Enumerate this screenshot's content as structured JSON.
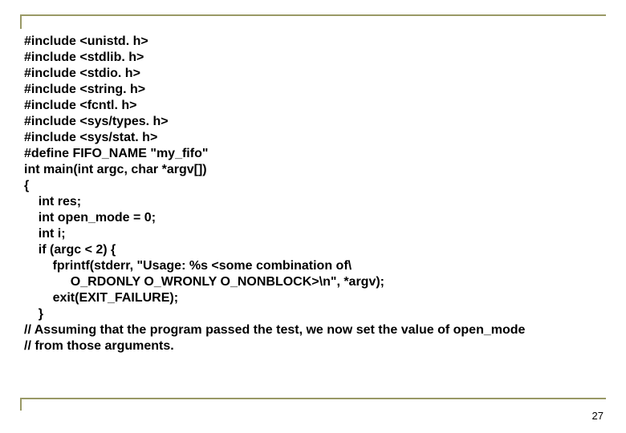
{
  "code": {
    "l1": "#include <unistd. h>",
    "l2": "#include <stdlib. h>",
    "l3": "#include <stdio. h>",
    "l4": "#include <string. h>",
    "l5": "#include <fcntl. h>",
    "l6": "#include <sys/types. h>",
    "l7": "#include <sys/stat. h>",
    "l8": "#define FIFO_NAME \"my_fifo\"",
    "l9": "int main(int argc, char *argv[])",
    "l10": "{",
    "l11": "    int res;",
    "l12": "    int open_mode = 0;",
    "l13": "    int i;",
    "l14": "    if (argc < 2) {",
    "l15": "        fprintf(stderr, \"Usage: %s <some combination of\\",
    "l16": "             O_RDONLY O_WRONLY O_NONBLOCK>\\n\", *argv);",
    "l17": "        exit(EXIT_FAILURE);",
    "l18": "    }",
    "l19": "// Assuming that the program passed the test, we now set the value of open_mode",
    "l20": "// from those arguments."
  },
  "page_number": "27"
}
